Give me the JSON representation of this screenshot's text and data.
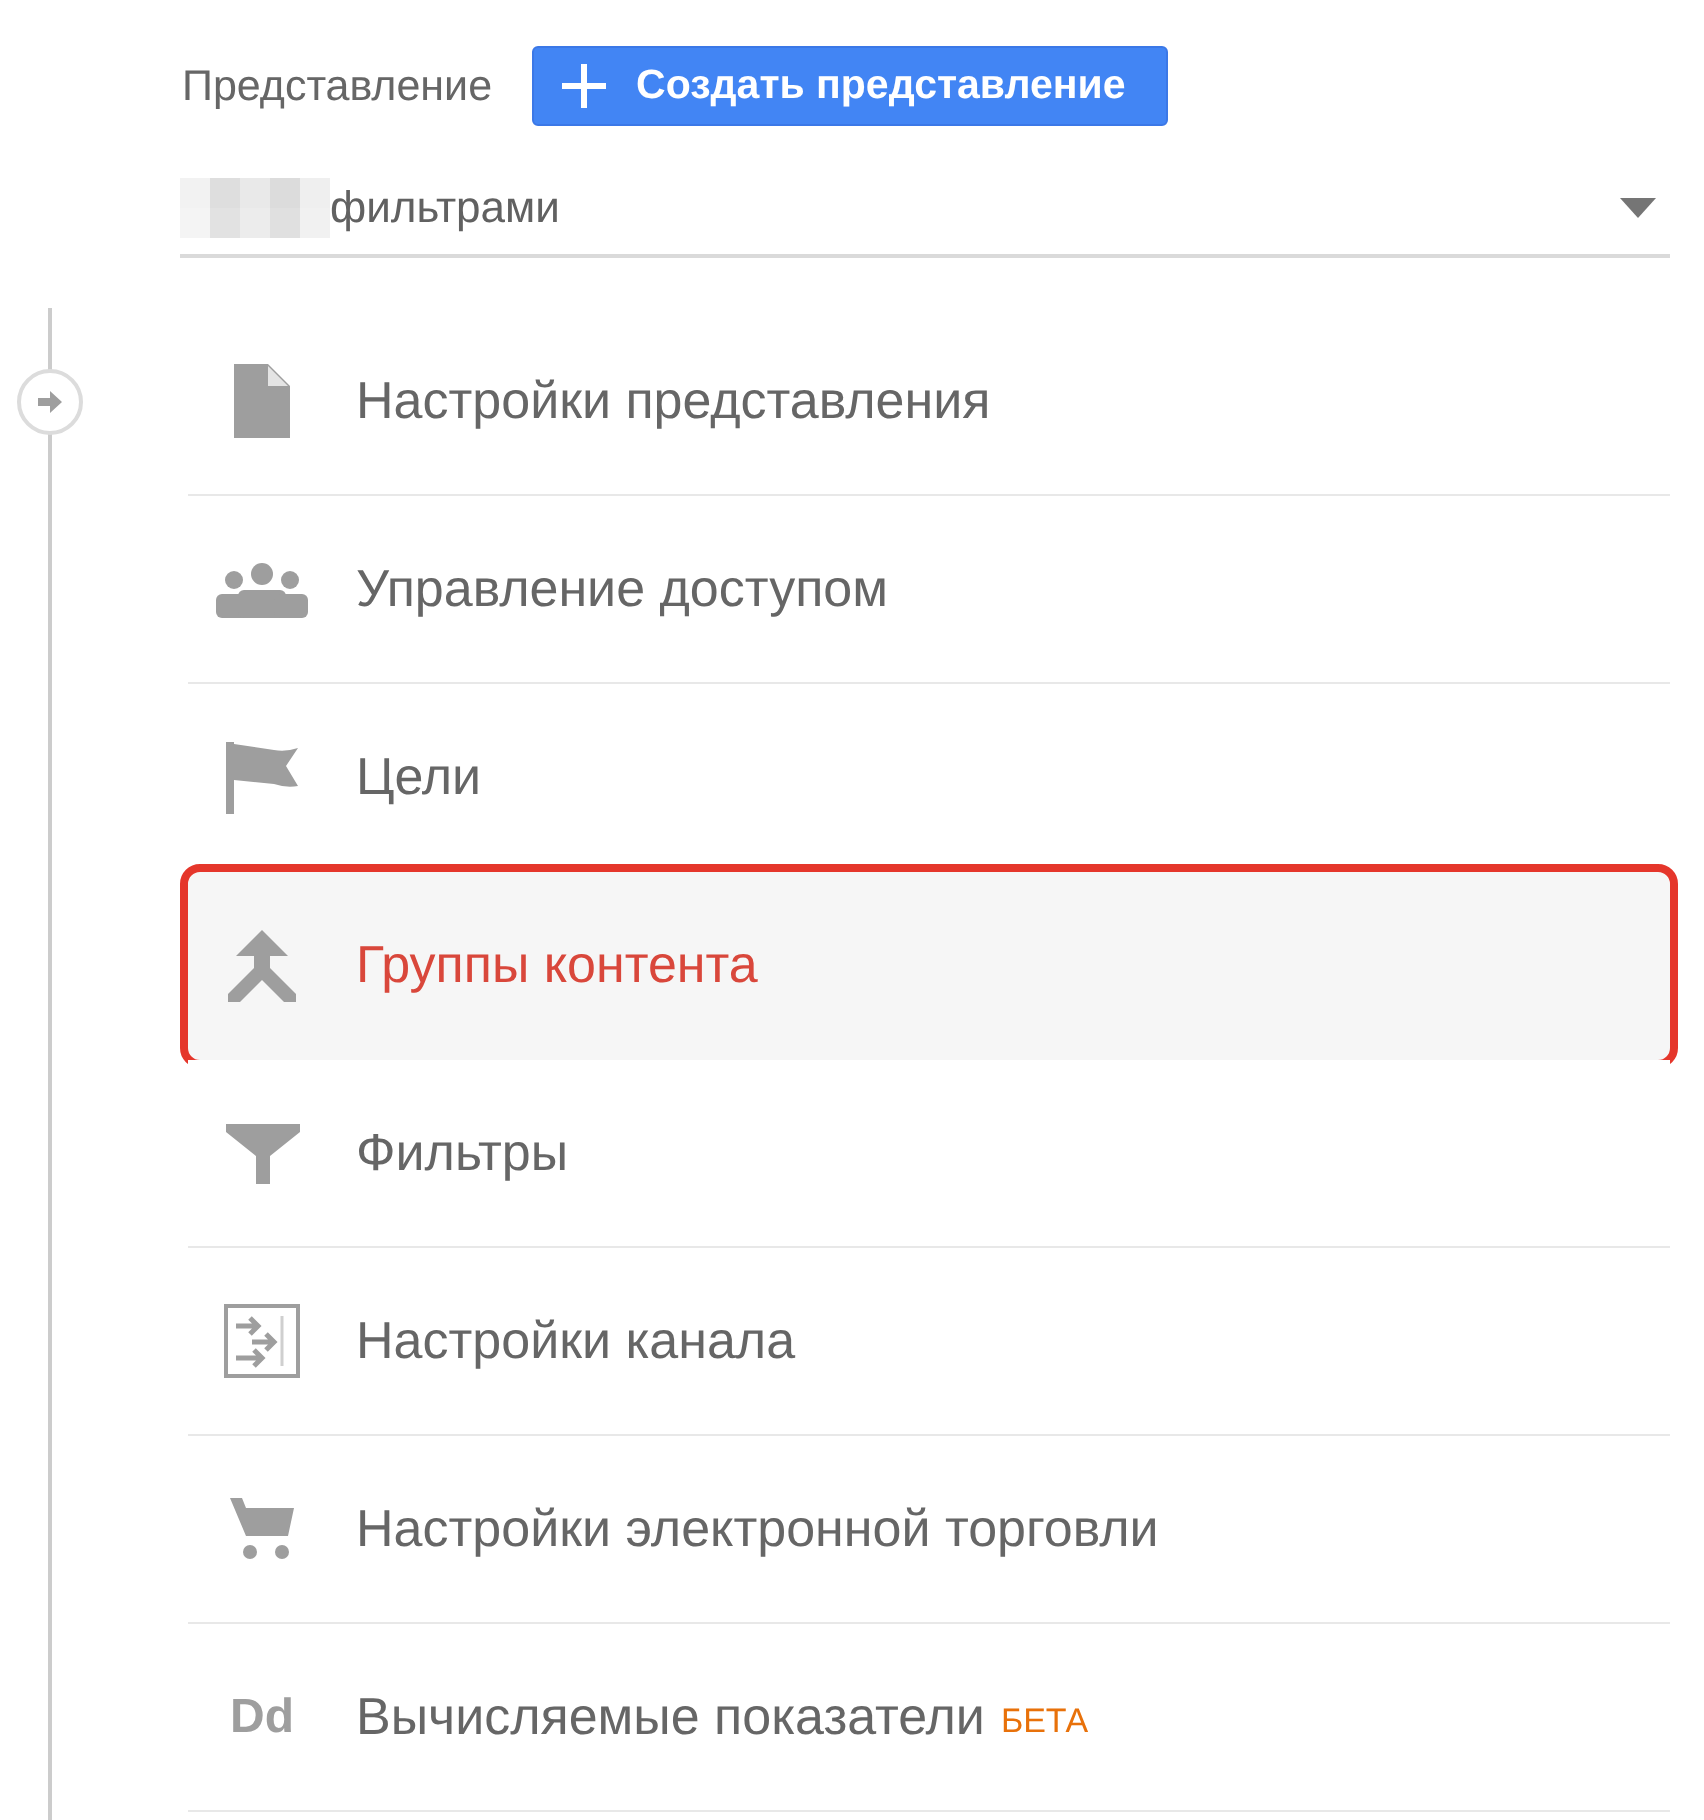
{
  "header": {
    "label": "Представление",
    "create_button": "Создать представление"
  },
  "view_select": {
    "value": "фильтрами"
  },
  "menu": [
    {
      "label": "Настройки представления",
      "selected": false
    },
    {
      "label": "Управление доступом",
      "selected": false
    },
    {
      "label": "Цели",
      "selected": false
    },
    {
      "label": "Группы контента",
      "selected": true
    },
    {
      "label": "Фильтры",
      "selected": false
    },
    {
      "label": "Настройки канала",
      "selected": false
    },
    {
      "label": "Настройки электронной торговли",
      "selected": false
    },
    {
      "label": "Вычисляемые показатели",
      "icon_text": "Dd",
      "badge": "БЕТА",
      "selected": false
    }
  ]
}
